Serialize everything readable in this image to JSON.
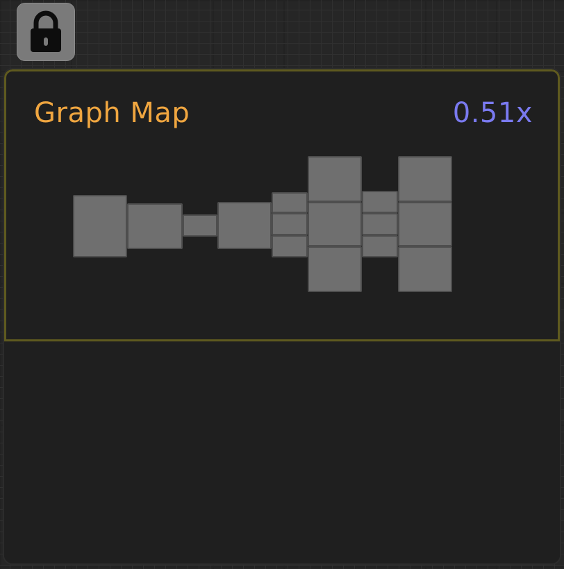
{
  "toolbar": {
    "lock_icon": "lock-icon"
  },
  "graph_map": {
    "title": "Graph Map",
    "zoom": "0.51x",
    "colors": {
      "title": "#f0a640",
      "zoom": "#7a7af0",
      "border": "#5f5a1f",
      "node_fill": "#6f6f6f"
    }
  }
}
